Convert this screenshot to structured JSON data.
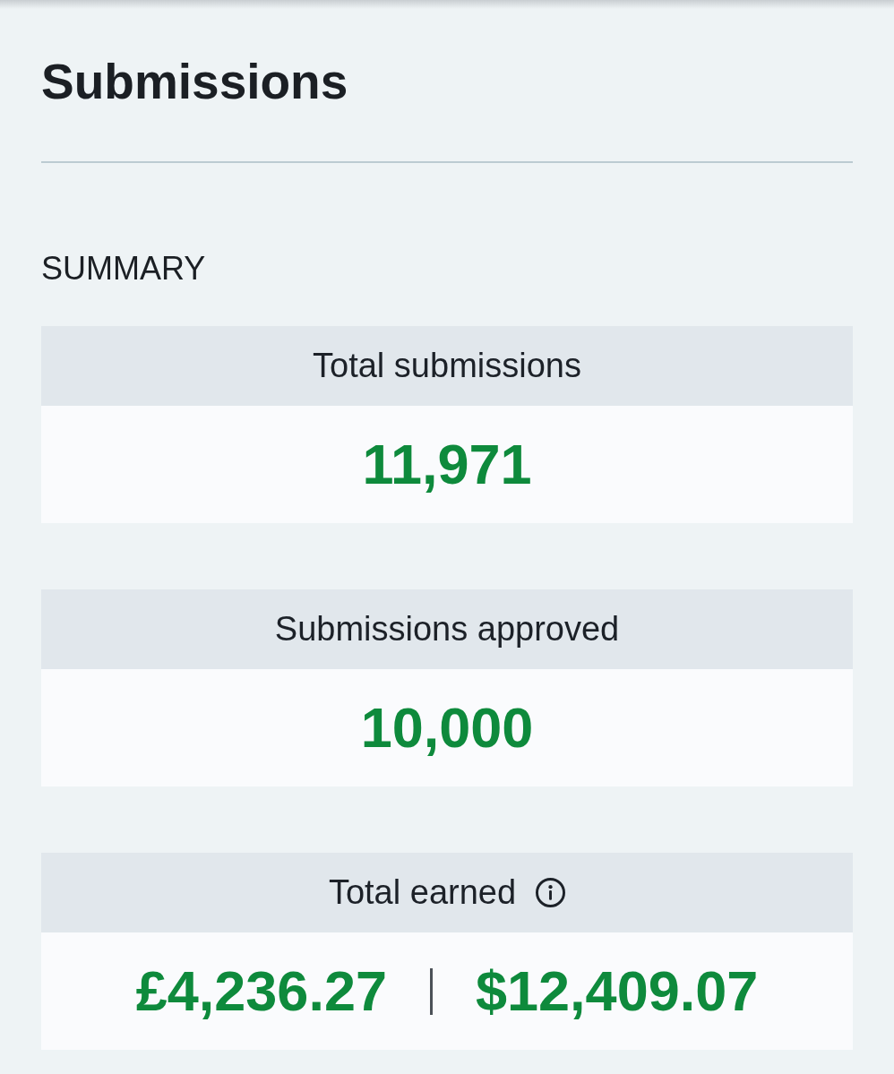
{
  "page": {
    "title": "Submissions"
  },
  "summary": {
    "heading": "SUMMARY",
    "cards": [
      {
        "label": "Total submissions",
        "info": false,
        "values": [
          "11,971"
        ]
      },
      {
        "label": "Submissions approved",
        "info": false,
        "values": [
          "10,000"
        ]
      },
      {
        "label": "Total earned",
        "info": true,
        "values": [
          "£4,236.27",
          "$12,409.07"
        ]
      }
    ]
  }
}
